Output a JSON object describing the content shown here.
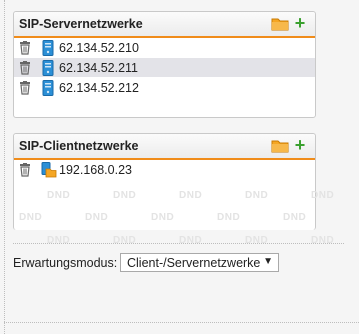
{
  "server_panel": {
    "title": "SIP-Servernetzwerke",
    "rows": [
      {
        "address": "62.134.52.210",
        "selected": false
      },
      {
        "address": "62.134.52.211",
        "selected": true
      },
      {
        "address": "62.134.52.212",
        "selected": false
      }
    ]
  },
  "client_panel": {
    "title": "SIP-Clientnetzwerke",
    "rows": [
      {
        "address": "192.168.0.23",
        "selected": false
      }
    ],
    "dnd_label": "DND"
  },
  "mode": {
    "label": "Erwartungsmodus:",
    "selected": "Client-/Servernetzwerke"
  },
  "colors": {
    "accent_orange": "#f08c1a",
    "plus_green": "#3aa02e",
    "device_blue": "#2b8fd6",
    "selected_row": "#e3e3e8"
  },
  "icons": {
    "folder": "folder-icon",
    "add": "plus-icon",
    "delete": "trash-icon",
    "server": "server-icon",
    "client": "client-icon"
  }
}
